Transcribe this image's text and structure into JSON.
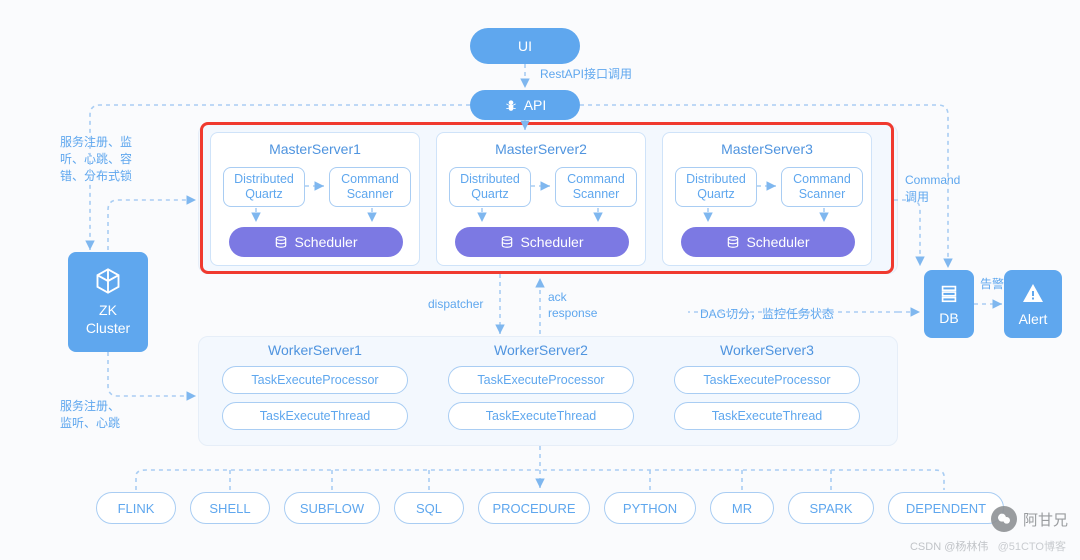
{
  "colors": {
    "primary": "#5fa7ee",
    "purple": "#7c79e3",
    "outline": "#a9cdf3",
    "red": "#f03a2f",
    "text_blue": "#4f94df"
  },
  "top": {
    "ui_label": "UI",
    "api_label": "API",
    "rest_label": "RestAPI接口调用"
  },
  "left": {
    "zk_title": "ZK\nCluster",
    "note_top": "服务注册、监听、心跳、容错、分布式锁",
    "note_bottom": "服务注册、监听、心跳"
  },
  "right": {
    "db_label": "DB",
    "alert_label": "Alert",
    "alert_note": "告警",
    "command_note": "Command调用",
    "dag_note": "DAG切分，监控任务状态"
  },
  "masters": [
    {
      "title": "MasterServer1",
      "box1": "Distributed\nQuartz",
      "box2": "Command\nScanner",
      "scheduler": "Scheduler"
    },
    {
      "title": "MasterServer2",
      "box1": "Distributed\nQuartz",
      "box2": "Command\nScanner",
      "scheduler": "Scheduler"
    },
    {
      "title": "MasterServer3",
      "box1": "Distributed\nQuartz",
      "box2": "Command\nScanner",
      "scheduler": "Scheduler"
    }
  ],
  "mid_labels": {
    "dispatcher": "dispatcher",
    "ack": "ack\nresponse"
  },
  "workers": [
    {
      "title": "WorkerServer1",
      "proc": "TaskExecuteProcessor",
      "thread": "TaskExecuteThread"
    },
    {
      "title": "WorkerServer2",
      "proc": "TaskExecuteProcessor",
      "thread": "TaskExecuteThread"
    },
    {
      "title": "WorkerServer3",
      "proc": "TaskExecuteProcessor",
      "thread": "TaskExecuteThread"
    }
  ],
  "bottom_row": [
    "FLINK",
    "SHELL",
    "SUBFLOW",
    "SQL",
    "PROCEDURE",
    "PYTHON",
    "MR",
    "SPARK",
    "DEPENDENT"
  ],
  "watermarks": {
    "w1": "阿甘兄",
    "w2": "CSDN @杨林伟",
    "w3": "@51CTO博客"
  }
}
